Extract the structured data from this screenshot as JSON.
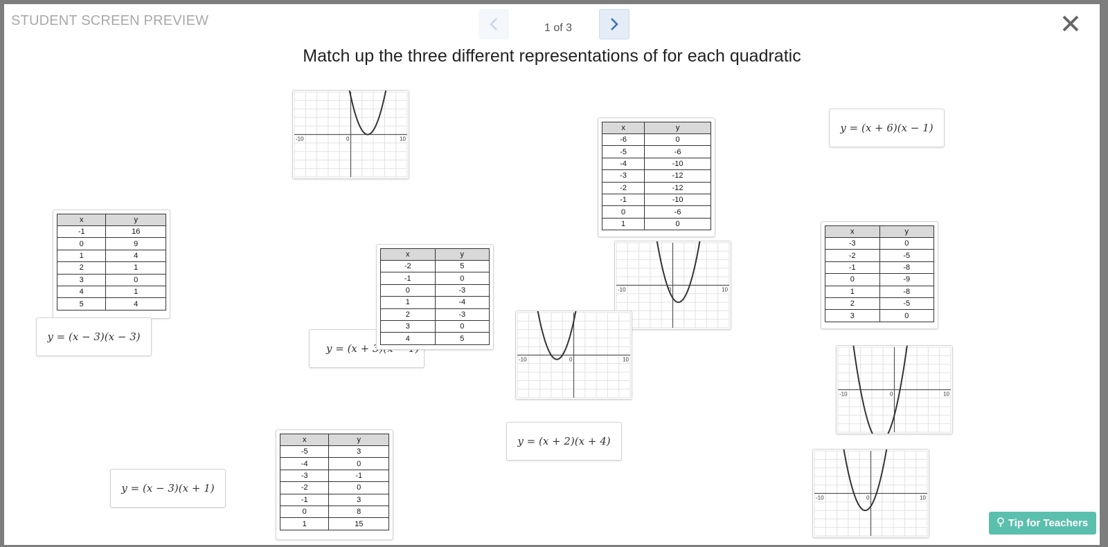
{
  "modal": {
    "label": "STUDENT SCREEN PREVIEW",
    "page_indicator": "1 of 3",
    "close_icon": "close-icon",
    "prev_icon": "chevron-left-icon",
    "next_icon": "chevron-right-icon"
  },
  "title": "Match up the three different representations of for each quadratic",
  "tip_button": {
    "label": "Tip for Teachers",
    "icon": "lightbulb-icon"
  },
  "table_headers": {
    "x": "x",
    "y": "y"
  },
  "graph_labels": {
    "min": "-10",
    "zero": "0",
    "max": "10"
  },
  "equations": [
    {
      "id": "eq1",
      "text": "y = (x + 6)(x − 1)"
    },
    {
      "id": "eq2",
      "text": "y = (x − 3)(x − 3)"
    },
    {
      "id": "eq3",
      "text": "y = (x + 3)(x − 1)"
    },
    {
      "id": "eq4",
      "text": "y = (x + 2)(x + 4)"
    },
    {
      "id": "eq5",
      "text": "y = (x − 3)(x + 1)"
    }
  ],
  "tables": [
    {
      "id": "t1",
      "rows": [
        [
          "-6",
          "0"
        ],
        [
          "-5",
          "-6"
        ],
        [
          "-4",
          "-10"
        ],
        [
          "-3",
          "-12"
        ],
        [
          "-2",
          "-12"
        ],
        [
          "-1",
          "-10"
        ],
        [
          "0",
          "-6"
        ],
        [
          "1",
          "0"
        ]
      ]
    },
    {
      "id": "t2",
      "rows": [
        [
          "-1",
          "16"
        ],
        [
          "0",
          "9"
        ],
        [
          "1",
          "4"
        ],
        [
          "2",
          "1"
        ],
        [
          "3",
          "0"
        ],
        [
          "4",
          "1"
        ],
        [
          "5",
          "4"
        ]
      ]
    },
    {
      "id": "t3",
      "rows": [
        [
          "-2",
          "5"
        ],
        [
          "-1",
          "0"
        ],
        [
          "0",
          "-3"
        ],
        [
          "1",
          "-4"
        ],
        [
          "2",
          "-3"
        ],
        [
          "3",
          "0"
        ],
        [
          "4",
          "5"
        ]
      ]
    },
    {
      "id": "t4",
      "rows": [
        [
          "-3",
          "0"
        ],
        [
          "-2",
          "-5"
        ],
        [
          "-1",
          "-8"
        ],
        [
          "0",
          "-9"
        ],
        [
          "1",
          "-8"
        ],
        [
          "2",
          "-5"
        ],
        [
          "3",
          "0"
        ]
      ]
    },
    {
      "id": "t5",
      "rows": [
        [
          "-5",
          "3"
        ],
        [
          "-4",
          "0"
        ],
        [
          "-3",
          "-1"
        ],
        [
          "-2",
          "0"
        ],
        [
          "-1",
          "3"
        ],
        [
          "0",
          "8"
        ],
        [
          "1",
          "15"
        ]
      ]
    }
  ],
  "graphs": [
    {
      "id": "g1",
      "roots": [
        3,
        3
      ]
    },
    {
      "id": "g2",
      "roots": [
        -1,
        3
      ]
    },
    {
      "id": "g3",
      "roots": [
        -4,
        -2
      ]
    },
    {
      "id": "g4",
      "roots": [
        -6,
        1
      ]
    },
    {
      "id": "g5",
      "roots": [
        -3,
        1
      ]
    }
  ]
}
